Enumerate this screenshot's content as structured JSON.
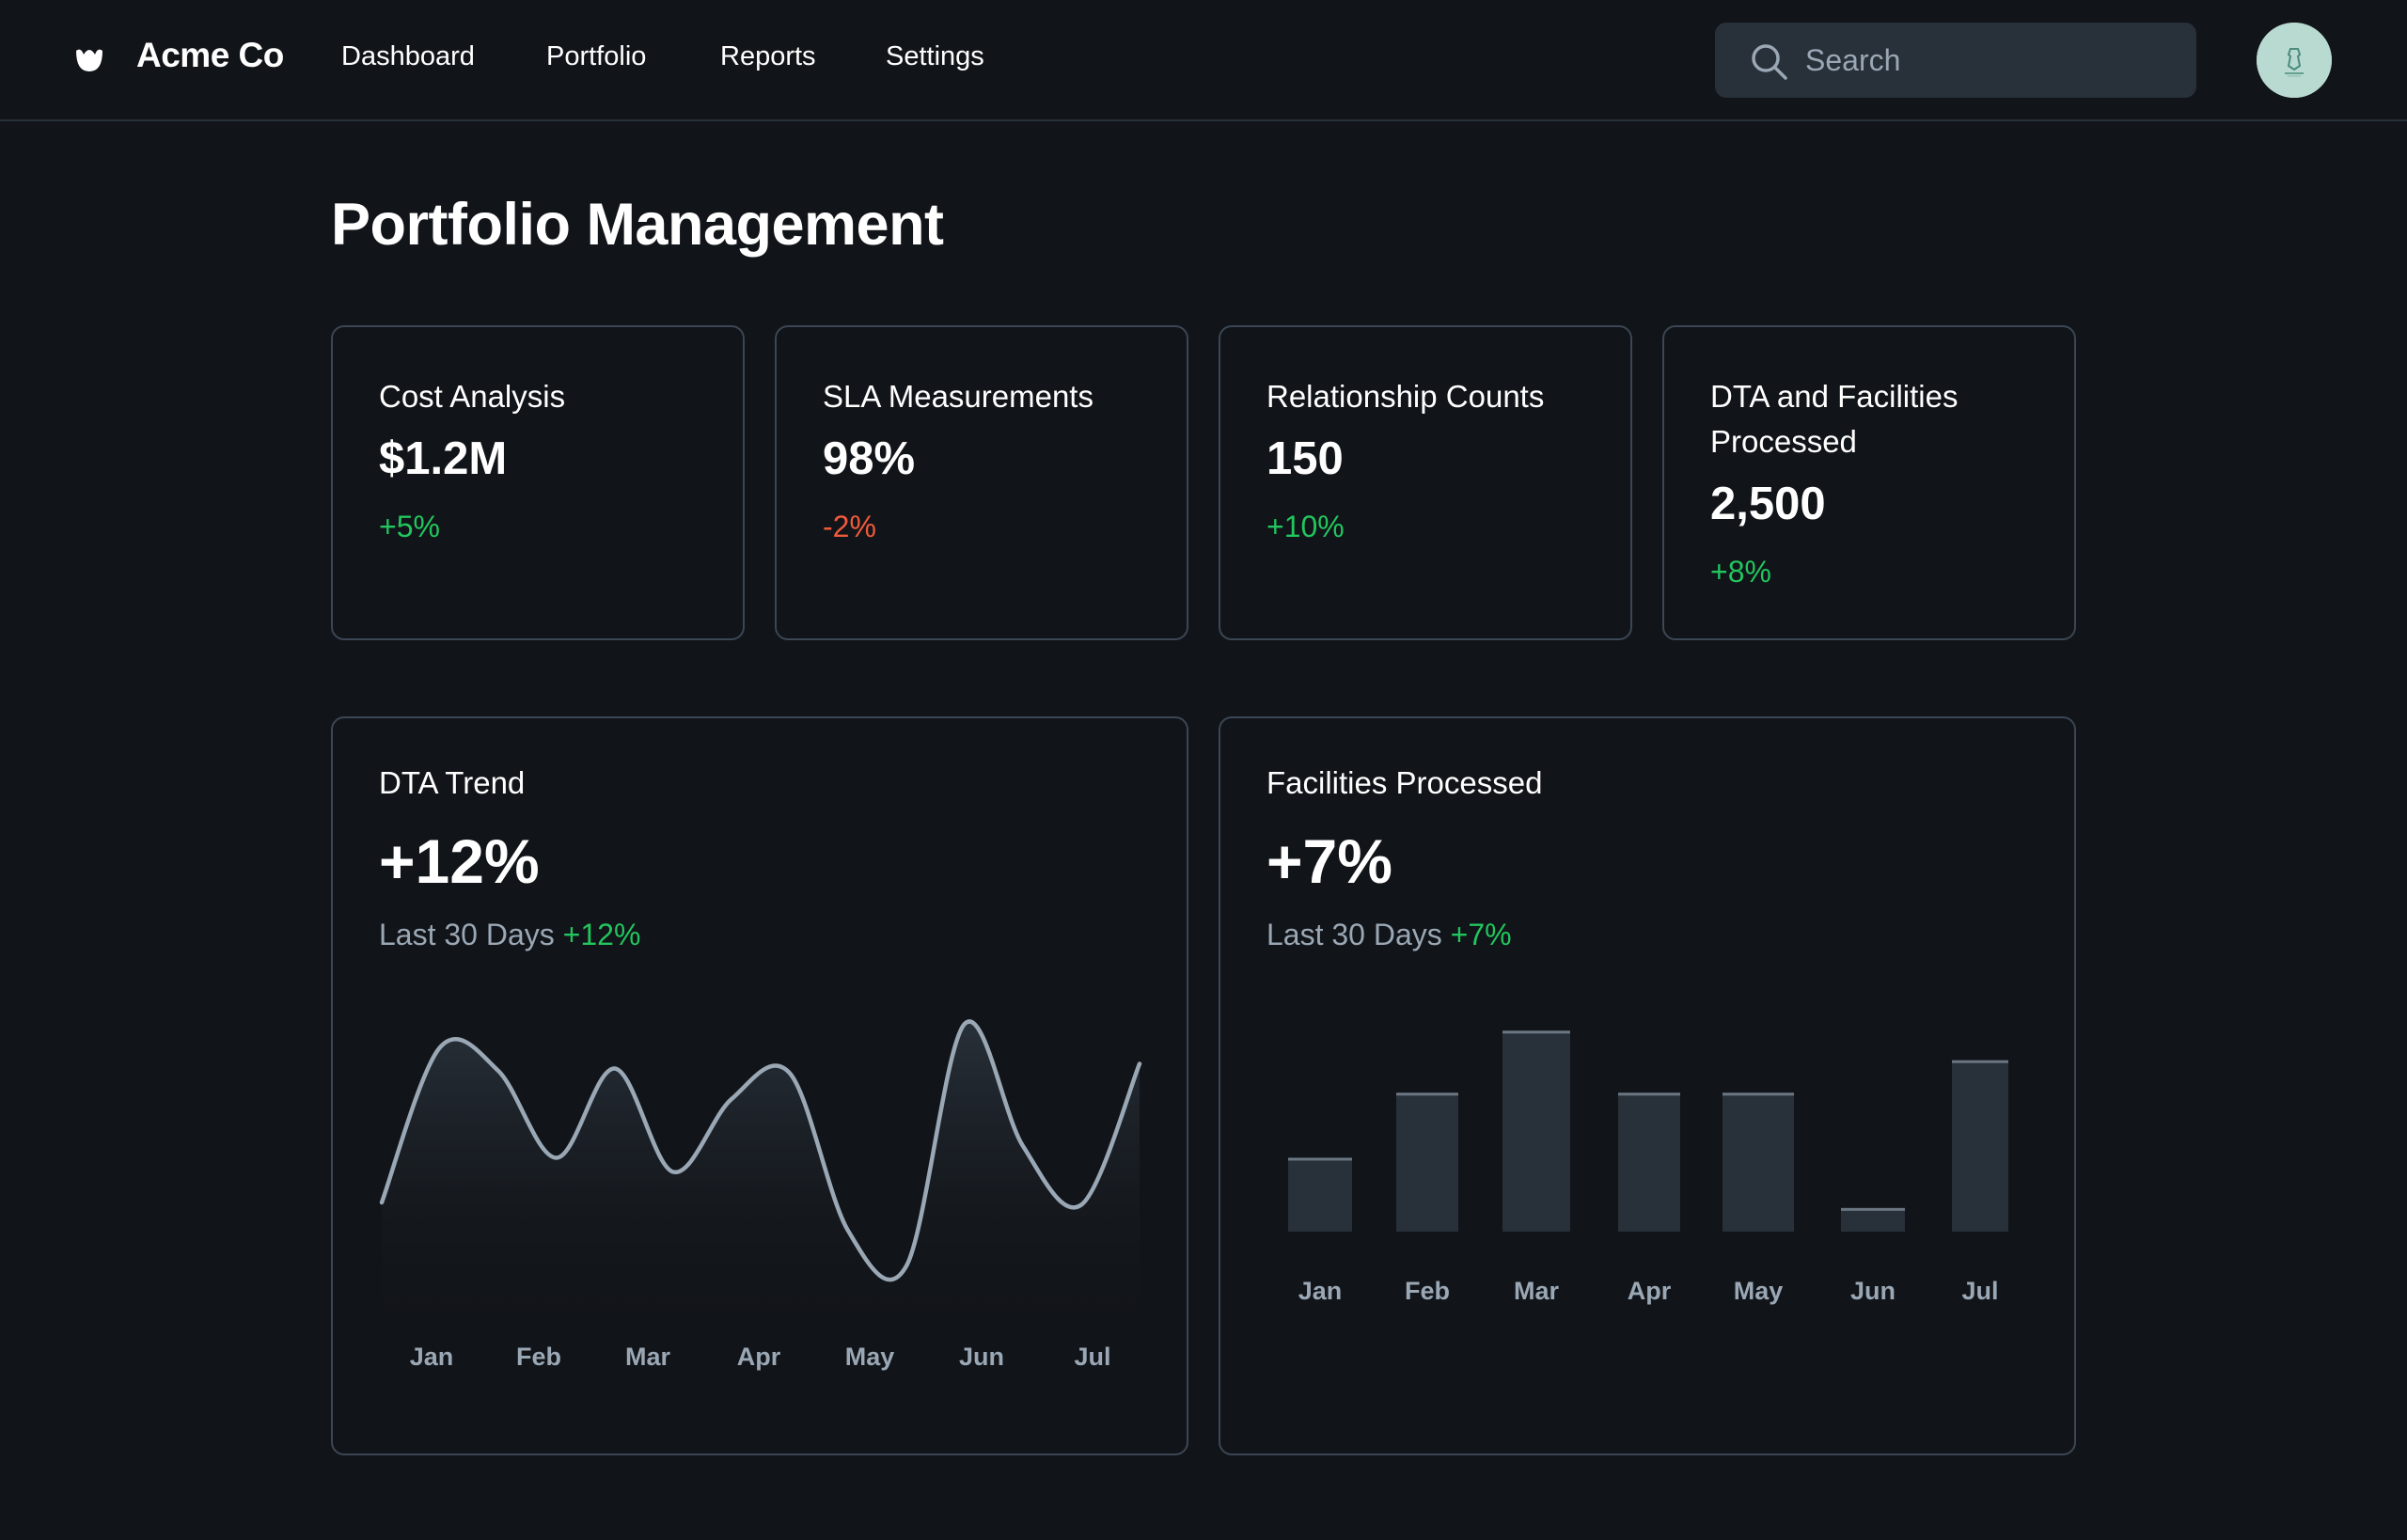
{
  "header": {
    "brand": "Acme Co",
    "nav": [
      "Dashboard",
      "Portfolio",
      "Reports",
      "Settings"
    ],
    "search_placeholder": "Search",
    "avatar_icon": "user-avatar"
  },
  "page": {
    "title": "Portfolio Management"
  },
  "stats": [
    {
      "label": "Cost Analysis",
      "value": "$1.2M",
      "change": "+5%",
      "trend": "up"
    },
    {
      "label": "SLA Measurements",
      "value": "98%",
      "change": "-2%",
      "trend": "down"
    },
    {
      "label": "Relationship Counts",
      "value": "150",
      "change": "+10%",
      "trend": "up"
    },
    {
      "label": "DTA and Facilities Processed",
      "value": "2,500",
      "change": "+8%",
      "trend": "up"
    }
  ],
  "charts": {
    "dta": {
      "label": "DTA Trend",
      "big": "+12%",
      "sub_prefix": "Last 30 Days",
      "sub_pct": "+12%"
    },
    "facilities": {
      "label": "Facilities Processed",
      "big": "+7%",
      "sub_prefix": "Last 30 Days",
      "sub_pct": "+7%"
    }
  },
  "colors": {
    "positive": "#22c55e",
    "negative": "#ef4444",
    "line": "#9aa7b5",
    "bar": "#283039",
    "bar_top": "#6b7683"
  },
  "chart_data": [
    {
      "type": "area",
      "categories": [
        "Jan",
        "Feb",
        "Mar",
        "Apr",
        "May",
        "Jun",
        "Jul"
      ],
      "x": [
        0.0,
        0.5,
        1.0,
        1.5,
        2.0,
        2.5,
        3.0,
        3.5,
        4.0,
        4.5,
        5.0,
        5.5,
        6.0,
        6.5
      ],
      "values": [
        14,
        80,
        70,
        33,
        71,
        27,
        58,
        69,
        2,
        -13,
        90,
        38,
        13,
        73
      ],
      "ylim": [
        -20,
        100
      ],
      "title": "",
      "xlabel": "",
      "ylabel": ""
    },
    {
      "type": "bar",
      "categories": [
        "Jan",
        "Feb",
        "Mar",
        "Apr",
        "May",
        "Jun",
        "Jul"
      ],
      "values": [
        25,
        47,
        68,
        47,
        47,
        8,
        58
      ],
      "ylim": [
        0,
        70
      ],
      "title": "",
      "xlabel": "",
      "ylabel": ""
    }
  ]
}
